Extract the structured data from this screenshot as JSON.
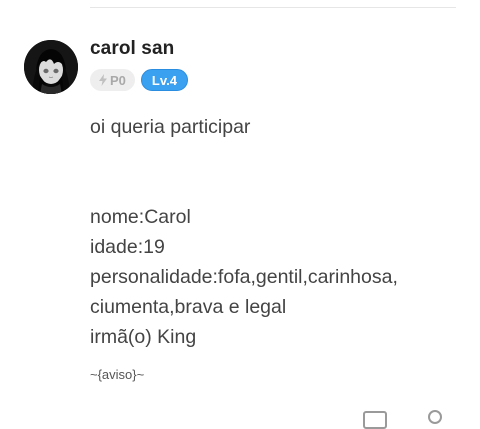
{
  "comment": {
    "author": {
      "name": "carol san",
      "avatar_icon": "anime-girl-avatar",
      "points_badge": "P0",
      "level_badge": "Lv.4",
      "level_color": "#3aa0f0"
    },
    "lines_intro": [
      "oi queria participar"
    ],
    "lines_form": [
      "nome:Carol",
      "idade:19",
      "personalidade:fofa,gentil,carinhosa,",
      "ciumenta,brava e legal",
      "irmã(o) King"
    ],
    "signature": "~{aviso}~"
  },
  "actions": {
    "comment_icon": "comment-icon",
    "like_icon": "like-icon"
  }
}
